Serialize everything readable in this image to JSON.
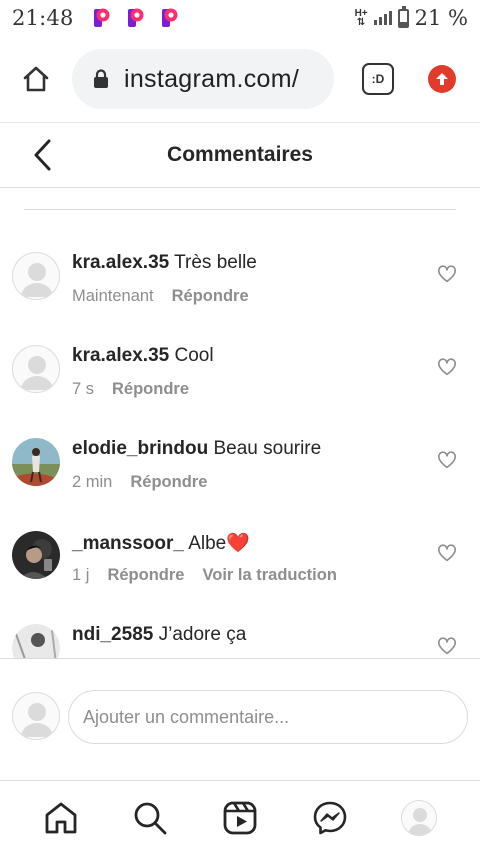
{
  "status_bar": {
    "time": "21:48",
    "battery_text": "21 %",
    "network_label": "H+",
    "battery_level": 0.21,
    "notification_icons": [
      "p-app-icon",
      "p-app-icon",
      "p-app-icon"
    ]
  },
  "browser": {
    "url": "instagram.com/",
    "tabs_label": ":D",
    "icons": {
      "home": "home-icon",
      "lock": "lock-icon",
      "update": "update-arrow-icon"
    },
    "update_color": "#e03b2b"
  },
  "header": {
    "title": "Commentaires",
    "back_icon": "chevron-left-icon"
  },
  "comments": [
    {
      "username": "kra.alex.35",
      "text": "Très belle",
      "time": "Maintenant",
      "reply": "Répondre",
      "translate": "",
      "avatar": "default-avatar"
    },
    {
      "username": "kra.alex.35",
      "text": "Cool",
      "time": "7 s",
      "reply": "Répondre",
      "translate": "",
      "avatar": "default-avatar"
    },
    {
      "username": "elodie_brindou",
      "text": "Beau sourire",
      "time": "2 min",
      "reply": "Répondre",
      "translate": "",
      "avatar": "photo-avatar"
    },
    {
      "username": "_manssoor_",
      "text": "Albe❤️",
      "time": "1 j",
      "reply": "Répondre",
      "translate": "Voir la traduction",
      "avatar": "photo-avatar"
    },
    {
      "username": "ndi_2585",
      "text": "J’adore ça",
      "time": "",
      "reply": "",
      "translate": "",
      "avatar": "photo-avatar"
    }
  ],
  "add_comment": {
    "placeholder": "Ajouter un commentaire..."
  },
  "bottom_nav": {
    "items": [
      "home-icon",
      "search-icon",
      "reels-icon",
      "messenger-icon",
      "profile-avatar"
    ]
  },
  "colors": {
    "text": "#262626",
    "secondary_text": "#8e8e8e",
    "border": "#dbdbdb",
    "p_icon": "#7b1fd6",
    "p_icon_accent": "#ff2d6f"
  }
}
